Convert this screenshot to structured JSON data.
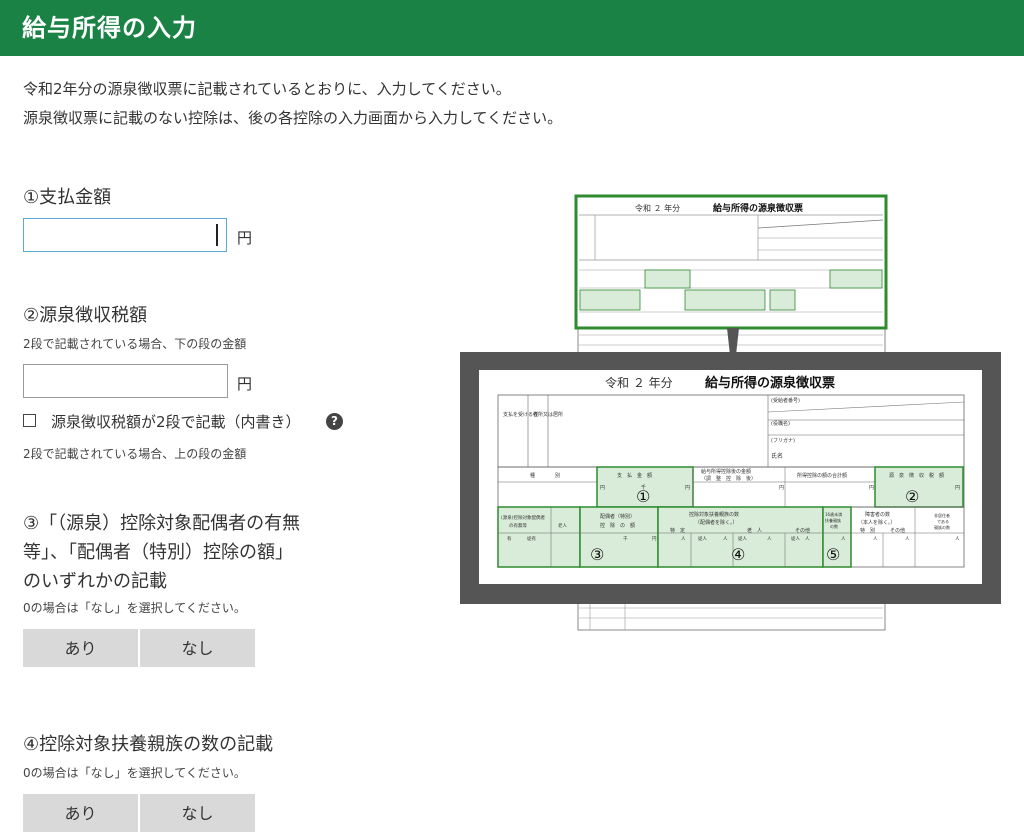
{
  "header": {
    "title": "給与所得の入力"
  },
  "intro": {
    "line1": "令和2年分の源泉徴収票に記載されているとおりに、入力してください。",
    "line2": "源泉徴収票に記載のない控除は、後の各控除の入力画面から入力してください。"
  },
  "fields": {
    "payment": {
      "label": "①支払金額",
      "value": "",
      "unit": "円"
    },
    "withholding": {
      "label": "②源泉徴収税額",
      "note": "2段で記載されている場合、下の段の金額",
      "value": "",
      "unit": "円",
      "checkbox_label": "源泉徴収税額が2段で記載（内書き）",
      "help_icon": "?",
      "checkbox_note": "2段で記載されている場合、上の段の金額"
    },
    "spouse": {
      "label_lines": [
        "③「（源泉）控除対象配偶者の有無",
        "等」、「配偶者（特別）控除の額」",
        "のいずれかの記載"
      ],
      "note": "0の場合は「なし」を選択してください。",
      "yes": "あり",
      "no": "なし"
    },
    "dependents": {
      "label": "④控除対象扶養親族の数の記載",
      "note": "0の場合は「なし」を選択してください。",
      "yes": "あり",
      "no": "なし"
    }
  },
  "form_image": {
    "top_title_era": "令和 ２ 年分",
    "top_title": "給与所得の源泉徴収票",
    "zoom_title_era": "令和 ２ 年分",
    "zoom_title": "給与所得の源泉徴収票",
    "col_shubetsu": "種　　　　別",
    "col_shiharai": "支　払　金　額",
    "col_kyuyo_line1": "給与所得控除後の金額",
    "col_kyuyo_line2": "（調　整　控　除　後）",
    "col_shotoku_koujo": "所得控除の額の合計額",
    "col_gensen": "源　泉　徴　収　税　額",
    "col_spouse_line1": "(源泉)控除対象配偶者",
    "col_spouse_line2": "の有無等",
    "col_rojin": "老人",
    "col_haigusha_line1": "配偶者（特別）",
    "col_haigusha_line2": "控　除　の　額",
    "col_fuyou_line1": "控除対象扶養親族の数",
    "col_fuyou_line2": "（配偶者を除く。）",
    "col_tokutei": "特　定",
    "col_rojin2": "老　人",
    "col_sonota": "その他",
    "col_16sai_line1": "16歳未満",
    "col_16sai_line2": "扶養親族",
    "col_16sai_line3": "の数",
    "col_shogai_line1": "障害者の数",
    "col_shogai_line2": "（本人を除く。）",
    "col_tokubetsu": "特　別",
    "col_sonota2": "その他",
    "col_hikyoju_line1": "非居住者",
    "col_hikyoju_line2": "である",
    "col_hikyoju_line3": "親族の数",
    "left_block": "支払を受ける者",
    "addr_label": "住所又は居所",
    "ukekyu": "(受給者番号)",
    "yakushoku": "(役職名)",
    "shimei": "氏名",
    "furigana": "(フリガナ)",
    "yen": "円",
    "sen": "千",
    "nin": "人",
    "jukyo": "従人",
    "ari": "有",
    "jukyo2": "従有",
    "n1": "①",
    "n2": "②",
    "n3": "③",
    "n4": "④",
    "n5": "⑤"
  }
}
